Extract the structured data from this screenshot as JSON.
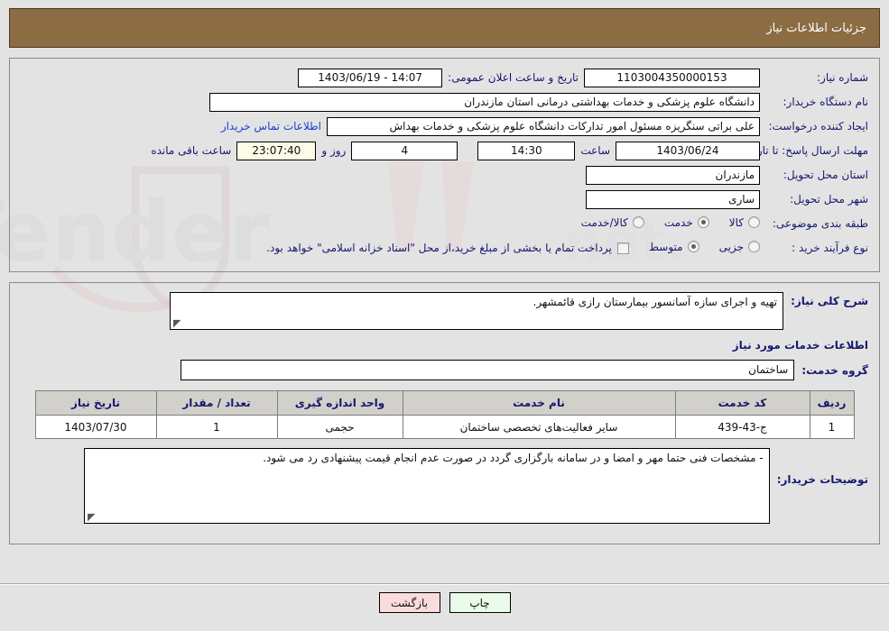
{
  "header": {
    "title": "جزئیات اطلاعات نیاز"
  },
  "form": {
    "need_number_label": "شماره نیاز:",
    "need_number_value": "1103004350000153",
    "announce_label": "تاریخ و ساعت اعلان عمومی:",
    "announce_value": "14:07 - 1403/06/19",
    "buyer_org_label": "نام دستگاه خریدار:",
    "buyer_org_value": "دانشگاه علوم پزشکی و خدمات بهداشتی  درمانی استان مازندران",
    "creator_label": "ایجاد کننده درخواست:",
    "creator_value": "علی براتی سنگریزه مسئول امور تدارکات دانشگاه علوم پزشکی و خدمات بهداش",
    "contact_link": "اطلاعات تماس خریدار",
    "deadline_label": "مهلت ارسال پاسخ: تا تاریخ:",
    "deadline_date": "1403/06/24",
    "hour_label": "ساعت",
    "deadline_time": "14:30",
    "days_value": "4",
    "days_label": "روز و",
    "remaining_time": "23:07:40",
    "remaining_label": "ساعت باقی مانده",
    "province_label": "استان محل تحویل:",
    "province_value": "مازندران",
    "city_label": "شهر محل تحویل:",
    "city_value": "ساری",
    "category_label": "طبقه بندی موضوعی:",
    "category_options": [
      {
        "label": "کالا",
        "checked": false
      },
      {
        "label": "خدمت",
        "checked": true
      },
      {
        "label": "کالا/خدمت",
        "checked": false
      }
    ],
    "process_label": "نوع فرآیند خرید :",
    "process_options": [
      {
        "label": "جزیی",
        "checked": false
      },
      {
        "label": "متوسط",
        "checked": true
      }
    ],
    "treasury_checkbox_label": "پرداخت تمام یا بخشی از مبلغ خرید،از محل \"اسناد خزانه اسلامی\" خواهد بود.",
    "treasury_checked": false
  },
  "details": {
    "desc_label": "شرح کلی نیاز:",
    "desc_value": "تهیه و اجرای سازه آسانسور بیمارستان رازی قائمشهر.",
    "section_title": "اطلاعات خدمات مورد نیاز",
    "service_group_label": "گروه خدمت:",
    "service_group_value": "ساختمان",
    "notes_label": "توضیحات خریدار:",
    "notes_value": "-  مشخصات فنی حتما مهر و امضا و در سامانه بارگزاری گردد در صورت عدم انجام قیمت پیشنهادی رد می شود."
  },
  "table": {
    "columns": [
      "ردیف",
      "کد خدمت",
      "نام خدمت",
      "واحد اندازه گیری",
      "تعداد / مقدار",
      "تاریخ نیاز"
    ],
    "rows": [
      {
        "index": "1",
        "code": "ج-43-439",
        "name": "سایر فعالیت‌های تخصصی ساختمان",
        "unit": "حجمی",
        "qty": "1",
        "need_date": "1403/07/30"
      }
    ]
  },
  "footer": {
    "print_label": "چاپ",
    "back_label": "بازگشت"
  },
  "colors": {
    "header_brown": "#8c6d43",
    "page_bg": "#e3e3e3",
    "label_blue": "#15186e",
    "link_blue": "#1a3fd0",
    "print_btn": "#e9fbe9",
    "back_btn": "#fbdcdc"
  }
}
